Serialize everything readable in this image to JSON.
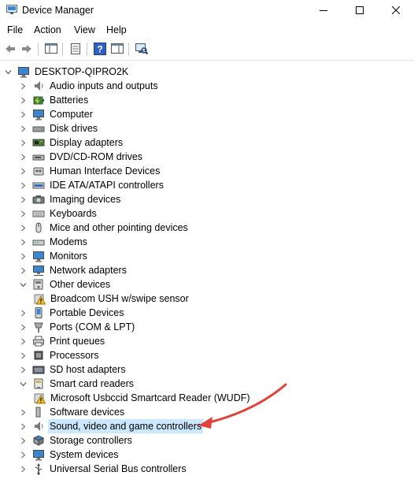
{
  "window": {
    "title": "Device Manager"
  },
  "menu": [
    "File",
    "Action",
    "View",
    "Help"
  ],
  "tree": {
    "root": "DESKTOP-QIPRO2K",
    "items": [
      {
        "label": "Audio inputs and outputs",
        "icon": "speaker-icon"
      },
      {
        "label": "Batteries",
        "icon": "battery-icon"
      },
      {
        "label": "Computer",
        "icon": "monitor-icon"
      },
      {
        "label": "Disk drives",
        "icon": "disk-icon"
      },
      {
        "label": "Display adapters",
        "icon": "display-adapter-icon"
      },
      {
        "label": "DVD/CD-ROM drives",
        "icon": "dvd-icon"
      },
      {
        "label": "Human Interface Devices",
        "icon": "hid-icon"
      },
      {
        "label": "IDE ATA/ATAPI controllers",
        "icon": "ide-icon"
      },
      {
        "label": "Imaging devices",
        "icon": "camera-icon"
      },
      {
        "label": "Keyboards",
        "icon": "keyboard-icon"
      },
      {
        "label": "Mice and other pointing devices",
        "icon": "mouse-icon"
      },
      {
        "label": "Modems",
        "icon": "modem-icon"
      },
      {
        "label": "Monitors",
        "icon": "monitor-icon"
      },
      {
        "label": "Network adapters",
        "icon": "network-icon"
      },
      {
        "label": "Other devices",
        "icon": "other-devices-icon",
        "expanded": true
      },
      {
        "label": "Broadcom USH w/swipe sensor",
        "icon": "warning-icon",
        "child": true
      },
      {
        "label": "Portable Devices",
        "icon": "portable-icon"
      },
      {
        "label": "Ports (COM & LPT)",
        "icon": "port-icon"
      },
      {
        "label": "Print queues",
        "icon": "printer-icon"
      },
      {
        "label": "Processors",
        "icon": "processor-icon"
      },
      {
        "label": "SD host adapters",
        "icon": "sd-icon"
      },
      {
        "label": "Smart card readers",
        "icon": "smartcard-icon",
        "expanded": true
      },
      {
        "label": "Microsoft Usbccid Smartcard Reader (WUDF)",
        "icon": "warning-icon",
        "child": true
      },
      {
        "label": "Software devices",
        "icon": "software-icon"
      },
      {
        "label": "Sound, video and game controllers",
        "icon": "speaker-icon",
        "selected": true
      },
      {
        "label": "Storage controllers",
        "icon": "storage-icon"
      },
      {
        "label": "System devices",
        "icon": "monitor-icon"
      },
      {
        "label": "Universal Serial Bus controllers",
        "icon": "usb-icon"
      }
    ]
  },
  "colors": {
    "selection": "#cce8ff",
    "arrow": "#e0433a"
  }
}
